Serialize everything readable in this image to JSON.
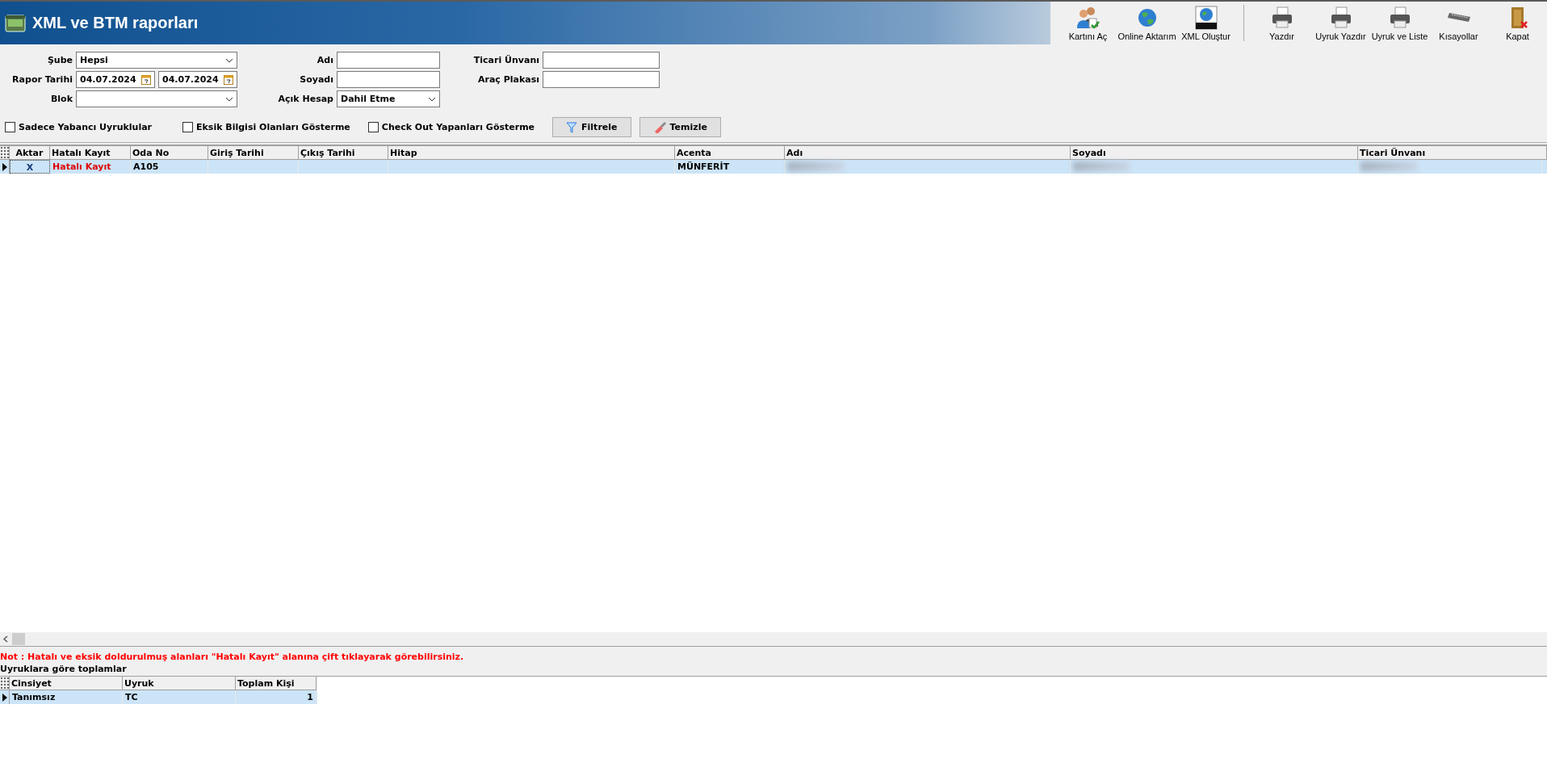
{
  "window": {
    "title": "XML ve BTM raporları"
  },
  "toolbar": [
    {
      "label": "Kartını Aç"
    },
    {
      "label": "Online Aktarım"
    },
    {
      "label": "XML Oluştur"
    },
    {
      "label": "Yazdır"
    },
    {
      "label": "Uyruk Yazdır"
    },
    {
      "label": "Uyruk ve Liste"
    },
    {
      "label": "Kısayollar"
    },
    {
      "label": "Kapat"
    }
  ],
  "filters": {
    "sube": {
      "label": "Şube",
      "value": "Hepsi"
    },
    "rapor_tarihi": {
      "label": "Rapor Tarihi",
      "from": "04.07.2024",
      "to": "04.07.2024"
    },
    "blok": {
      "label": "Blok"
    },
    "adi": {
      "label": "Adı"
    },
    "soyadi": {
      "label": "Soyadı"
    },
    "acik_hesap": {
      "label": "Açık Hesap",
      "value": "Dahil Etme"
    },
    "ticari_unvani": {
      "label": "Ticari Ünvanı"
    },
    "arac_plakasi": {
      "label": "Araç Plakası"
    }
  },
  "checkboxes": [
    {
      "label": "Sadece Yabancı Uyruklular",
      "checked": false
    },
    {
      "label": "Eksik Bilgisi Olanları Gösterme",
      "checked": false
    },
    {
      "label": "Check Out Yapanları Gösterme",
      "checked": false
    }
  ],
  "buttons": [
    {
      "label": "Filtrele"
    },
    {
      "label": "Temizle"
    }
  ],
  "table": {
    "columns": [
      "Aktar",
      "Hatalı Kayıt",
      "Oda No",
      "Giriş Tarihi",
      "Çıkış Tarihi",
      "Hitap",
      "Acenta",
      "Adı",
      "Soyadı",
      "Ticari Ünvanı"
    ],
    "rows": [
      {
        "aktar": "X",
        "hatali_kayit": "Hatalı Kayıt",
        "oda_no": "A105",
        "acenta": "MÜNFERİT",
        "selected": true
      }
    ]
  },
  "note": "Not : Hatalı ve eksik doldurulmuş alanları \"Hatalı Kayıt\" alanına çift tıklayarak görebilirsiniz.",
  "summary": {
    "title": "Uyruklara göre toplamlar",
    "columns": [
      "Cinsiyet",
      "Uyruk",
      "Toplam Kişi"
    ],
    "rows": [
      {
        "cinsiyet": "Tanımsız",
        "uyruk": "TC",
        "toplam_kisi": "1",
        "selected": true
      }
    ]
  }
}
